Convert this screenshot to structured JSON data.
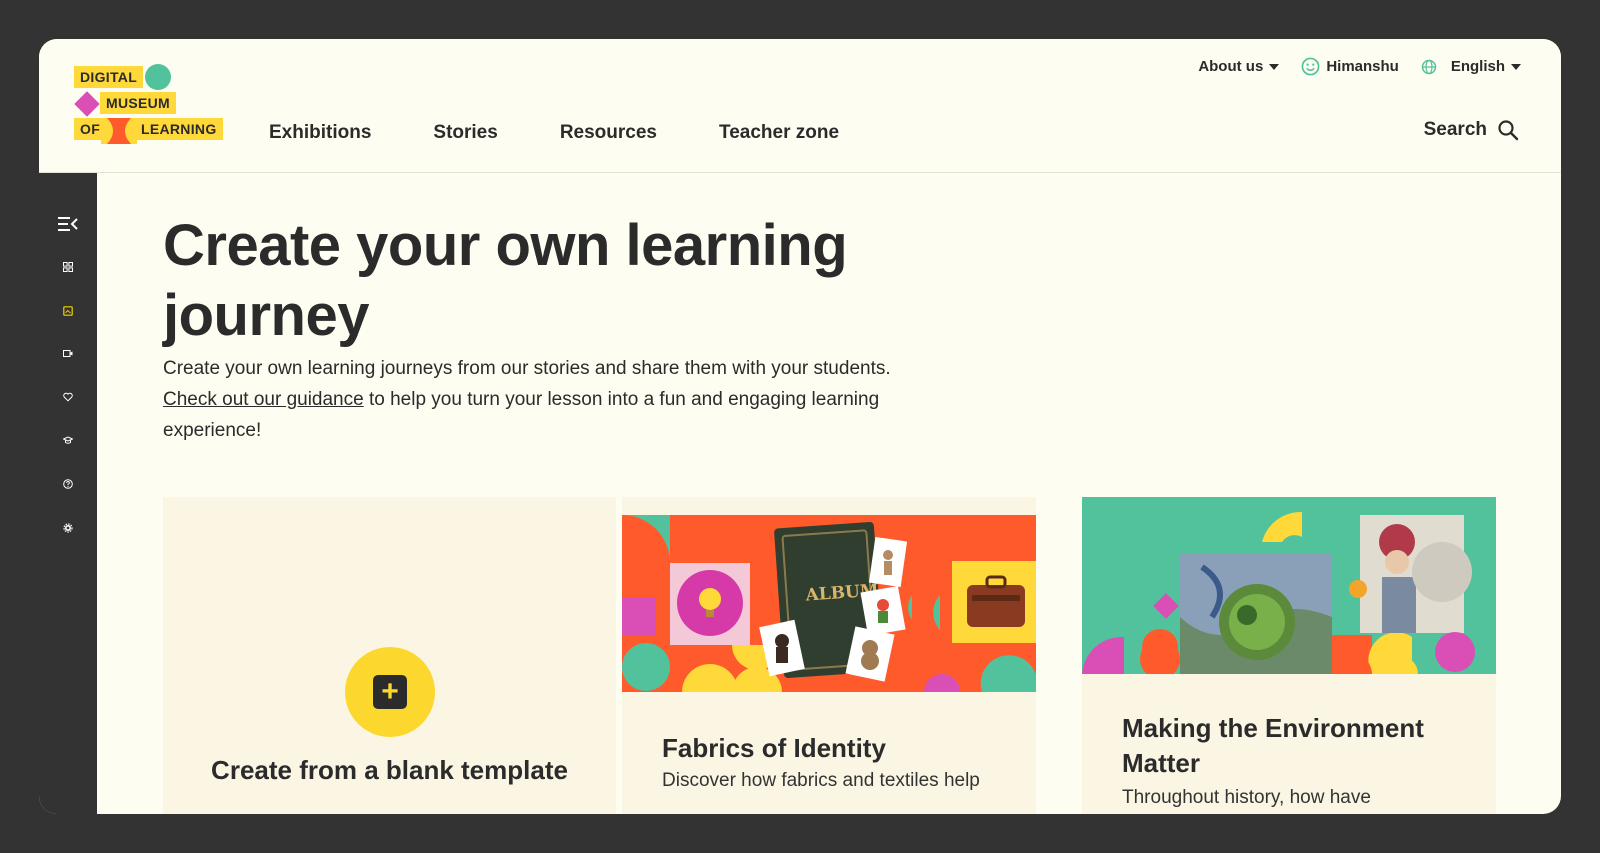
{
  "logo": {
    "line1": "DIGITAL",
    "line2": "MUSEUM",
    "line3a": "OF",
    "line3b": "LEARNING"
  },
  "header": {
    "about": "About us",
    "user": "Himanshu",
    "language": "English",
    "nav": [
      "Exhibitions",
      "Stories",
      "Resources",
      "Teacher zone"
    ],
    "search": "Search"
  },
  "sidebar": {
    "icons": [
      "collapse-menu-icon",
      "dashboard-icon",
      "learning-journeys-icon",
      "presentation-icon",
      "favourites-icon",
      "graduation-cap-icon",
      "help-icon",
      "settings-icon"
    ],
    "active_color": "#f5d000"
  },
  "hero": {
    "title": "Create your own learning journey",
    "desc_before": "Create your own learning journeys from our stories and share them with your students. ",
    "desc_link": "Check out our guidance",
    "desc_after": " to help you turn your lesson into a fun and engaging learning experience!"
  },
  "cards": {
    "blank": {
      "title": "Create from a blank template"
    },
    "c1": {
      "title": "Fabrics of Identity",
      "desc": "Discover how fabrics and textiles help"
    },
    "c2": {
      "title": "Making the Environment Matter",
      "desc": "Throughout history, how have"
    }
  },
  "colors": {
    "yellow": "#ffd83a",
    "teal": "#52c29c",
    "orange": "#ff5a2c",
    "magenta": "#d94fb5",
    "background": "#fefdf2"
  }
}
